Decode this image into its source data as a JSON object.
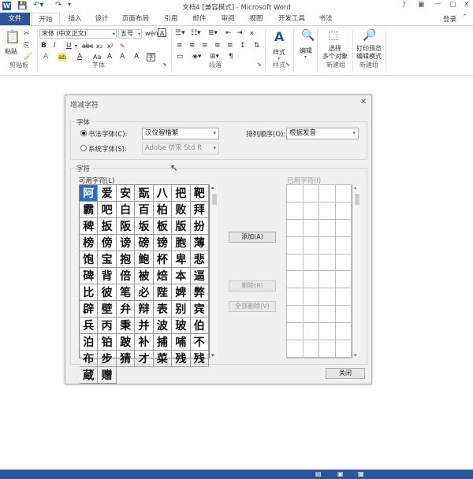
{
  "window": {
    "title": "文档4 [兼容模式] - Microsoft Word",
    "controls": [
      "?",
      "▢",
      "—",
      "▢",
      "✕"
    ]
  },
  "ribbon_tabs": {
    "file": "文件",
    "items": [
      "开始",
      "插入",
      "设计",
      "页面布局",
      "引用",
      "邮件",
      "审阅",
      "视图",
      "开发工具",
      "书法"
    ],
    "active": "开始",
    "login": "登录"
  },
  "ribbon": {
    "paste": "粘贴",
    "font_name": "宋体 (中文正文)",
    "font_size": "五号",
    "groups": [
      "剪贴板",
      "字体",
      "段落",
      "样式",
      "编辑",
      "新建组",
      "新建组"
    ],
    "styles": "样式",
    "editing": "编辑",
    "select_multi": "选择\n多个对象",
    "print_preview": "打印预览\n编辑模式"
  },
  "dialog": {
    "title": "增减字符",
    "font_section": "字体",
    "calligraphy_radio": "书法字体(C):",
    "calligraphy_value": "汉仪智楷繁",
    "system_radio": "系统字体(S):",
    "system_value": "Adobe 仿宋 Std R",
    "sort_label": "排列顺序(O):",
    "sort_value": "根据发音",
    "chars_section": "字符",
    "available_label": "可用字符(L)",
    "used_label": "已用字符(I)",
    "add_btn": "添加(A)",
    "remove_btn": "删除(R)",
    "remove_all_btn": "全部删除(V)",
    "close_btn": "关闭",
    "chars": [
      "阿",
      "爱",
      "安",
      "翫",
      "八",
      "把",
      "靶",
      "霸",
      "吧",
      "白",
      "百",
      "柏",
      "败",
      "拜",
      "稗",
      "扳",
      "阪",
      "坂",
      "板",
      "版",
      "扮",
      "榜",
      "傍",
      "谤",
      "磅",
      "镑",
      "胞",
      "薄",
      "饱",
      "宝",
      "抱",
      "鲍",
      "杯",
      "卑",
      "悲",
      "碑",
      "背",
      "倍",
      "被",
      "焙",
      "本",
      "逼",
      "比",
      "彼",
      "笔",
      "必",
      "陛",
      "婢",
      "弊",
      "辟",
      "壁",
      "弁",
      "辩",
      "表",
      "别",
      "宾",
      "兵",
      "丙",
      "秉",
      "并",
      "波",
      "玻",
      "伯",
      "泊",
      "铂",
      "跛",
      "补",
      "捕",
      "哺",
      "不",
      "布",
      "步",
      "猜",
      "才",
      "菜",
      "残",
      "残",
      "蔵",
      "赠"
    ]
  }
}
